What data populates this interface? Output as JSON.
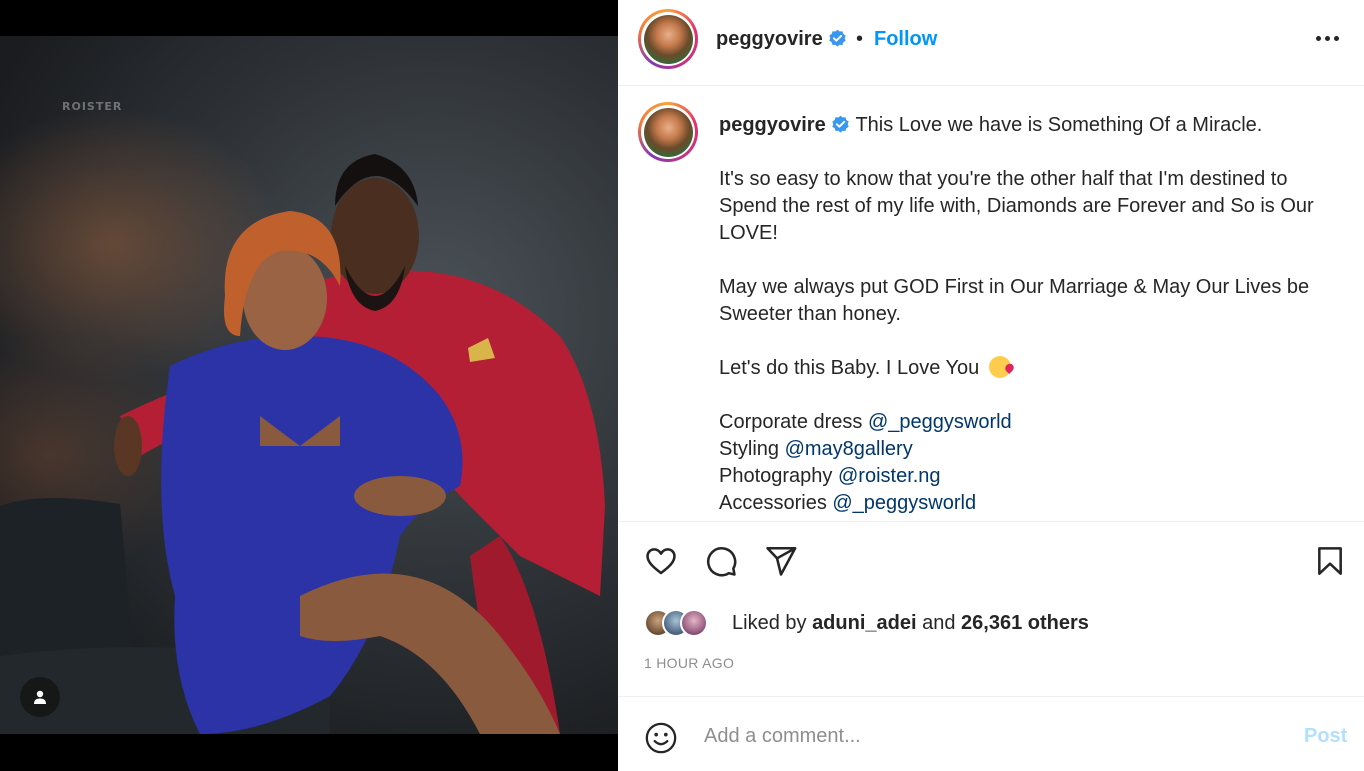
{
  "post": {
    "username": "peggyovire",
    "follow_label": "Follow",
    "header_separator": "•",
    "watermark": "ROISTER",
    "verified": true
  },
  "caption": {
    "username": "peggyovire",
    "lines": [
      "This Love we have is Something Of a Miracle.",
      "It's so easy to know that you're the other half that I'm destined to Spend the rest of my life with, Diamonds are Forever and So is Our LOVE!",
      "May we always put GOD First in Our Marriage & May Our Lives be Sweeter than honey.",
      "Let's do this Baby. I Love You"
    ],
    "emoji": "face-blowing-a-kiss",
    "credits": [
      {
        "label": "Corporate dress",
        "mention": "@_peggysworld"
      },
      {
        "label": "Styling",
        "mention": "@may8gallery"
      },
      {
        "label": "Photography",
        "mention": "@roister.ng"
      },
      {
        "label": "Accessories",
        "mention": "@_peggysworld"
      }
    ]
  },
  "engagement": {
    "liked_by_prefix": "Liked by",
    "liked_by_user": "aduni_adei",
    "and": "and",
    "others_count": "26,361 others",
    "timestamp": "1 HOUR AGO"
  },
  "comment_box": {
    "placeholder": "Add a comment...",
    "post_label": "Post"
  },
  "icons": {
    "like": "heart-icon",
    "comment": "comment-bubble-icon",
    "share": "paper-plane-icon",
    "save": "bookmark-icon",
    "emoji": "smiley-icon",
    "more": "more-options-icon",
    "user_tag": "user-icon"
  },
  "colors": {
    "link": "#0095f6",
    "mention": "#00376b",
    "muted": "#8e8e8e",
    "post_disabled": "#b2dffc",
    "verified": "#3897f0"
  }
}
